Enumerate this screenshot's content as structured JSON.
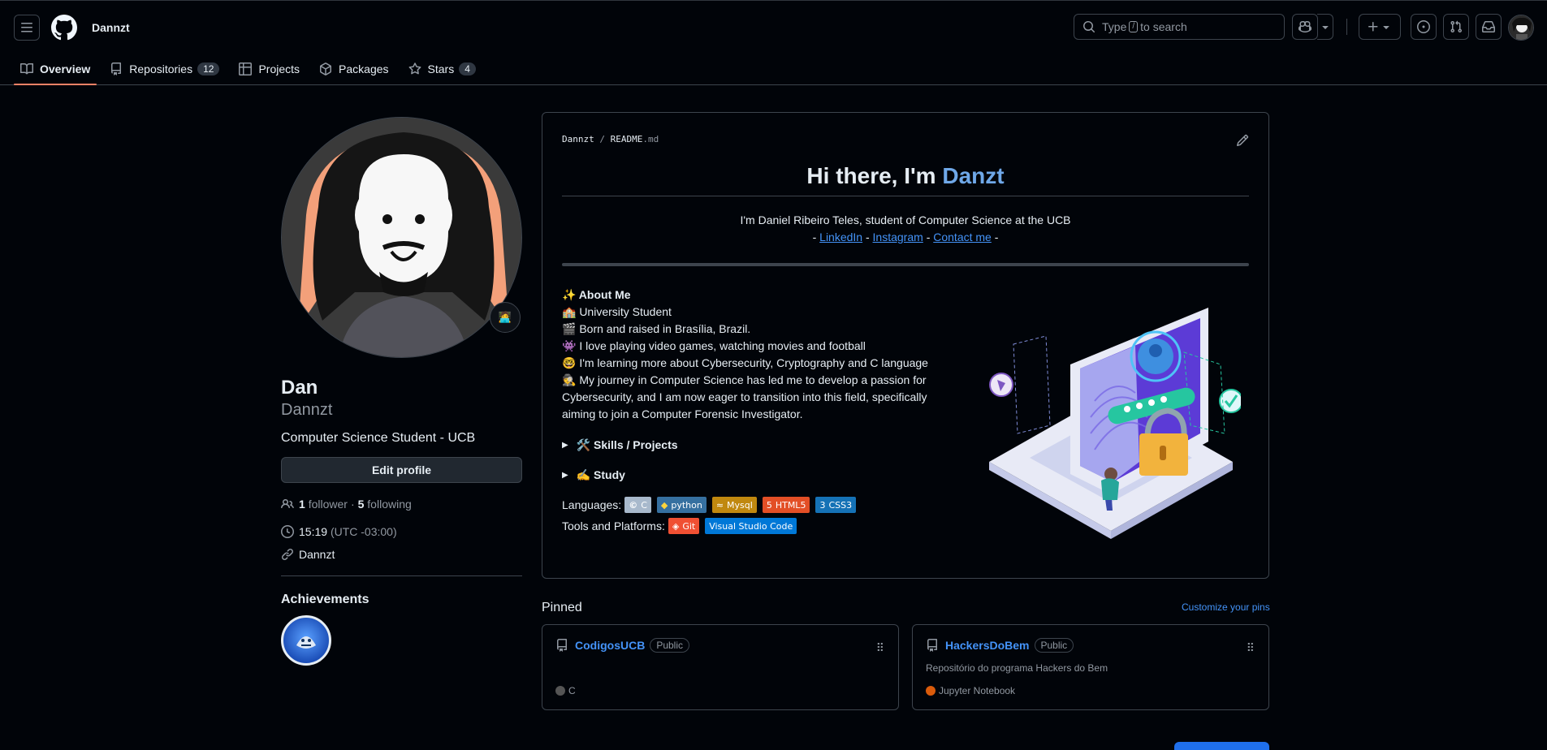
{
  "header": {
    "username": "Dannzt",
    "search_text_before": "Type",
    "search_key": "/",
    "search_text_after": "to search"
  },
  "tabs": [
    {
      "label": "Overview",
      "icon": "book-icon",
      "count": ""
    },
    {
      "label": "Repositories",
      "icon": "repo-icon",
      "count": "12"
    },
    {
      "label": "Projects",
      "icon": "table-icon",
      "count": ""
    },
    {
      "label": "Packages",
      "icon": "package-icon",
      "count": ""
    },
    {
      "label": "Stars",
      "icon": "star-icon",
      "count": "4"
    }
  ],
  "profile": {
    "name": "Dan",
    "login": "Dannzt",
    "bio": "Computer Science Student - UCB",
    "edit_label": "Edit profile",
    "followers_count": "1",
    "followers_label": "follower",
    "sep": "·",
    "following_count": "5",
    "following_label": "following",
    "time": "15:19",
    "timezone": "(UTC -03:00)",
    "link": "Dannzt",
    "status_emoji": "🧑‍💻",
    "achievements_title": "Achievements"
  },
  "readme": {
    "path_user": "Dannzt",
    "path_sep": "/",
    "path_file": "README",
    "path_ext": ".md",
    "title_prefix": "Hi there, I'm ",
    "title_name": "Danzt",
    "intro": "I'm Daniel Ribeiro Teles, student of Computer Science at the UCB",
    "links": [
      "LinkedIn",
      "Instagram",
      "Contact me"
    ],
    "link_sep": "-",
    "about_title": "✨ About Me",
    "about_lines": [
      "🏫 University Student",
      "🎬 Born and raised in Brasília, Brazil.",
      "👾 I love playing video games, watching movies and football",
      "🤓 I'm learning more about Cybersecurity, Cryptography and C language",
      "🕵️ My journey in Computer Science has led me to develop a passion for Cybersecurity, and I am now eager to transition into this field, specifically aiming to join a Computer Forensic Investigator."
    ],
    "details": [
      "🛠️ Skills / Projects",
      "✍️ Study"
    ],
    "languages_label": "Languages:",
    "languages": [
      {
        "label": "C",
        "color": "#a8b9cc"
      },
      {
        "label": "python",
        "color": "#3670a0"
      },
      {
        "label": "Mysql",
        "color": "#c0880f"
      },
      {
        "label": "HTML5",
        "color": "#e34f26"
      },
      {
        "label": "CSS3",
        "color": "#1572b6"
      }
    ],
    "tools_label": "Tools and Platforms:",
    "tools": [
      {
        "label": "Git",
        "color": "#f05033"
      },
      {
        "label": "Visual Studio Code",
        "color": "#0078d7"
      }
    ]
  },
  "pinned": {
    "title": "Pinned",
    "customize": "Customize your pins",
    "repos": [
      {
        "name": "CodigosUCB",
        "visibility": "Public",
        "description": "",
        "language": "C",
        "lang_color": "#555555"
      },
      {
        "name": "HackersDoBem",
        "visibility": "Public",
        "description": "Repositório do programa Hackers do Bem",
        "language": "Jupyter Notebook",
        "lang_color": "#da5b0b"
      }
    ]
  }
}
